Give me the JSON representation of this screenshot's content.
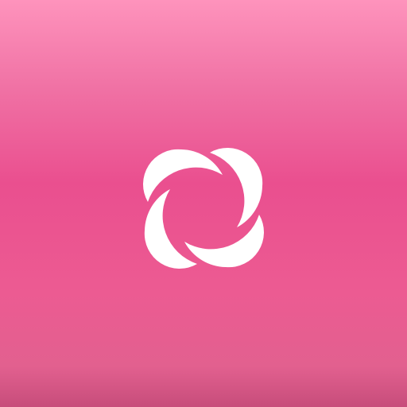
{
  "app_icon": {
    "logo_icon": "pinwheel-flower-icon",
    "colors": {
      "background_top": "#fe93bc",
      "background_mid": "#ea4f8f",
      "background_bottom": "#c74d7b",
      "logo": "#ffffff"
    }
  }
}
